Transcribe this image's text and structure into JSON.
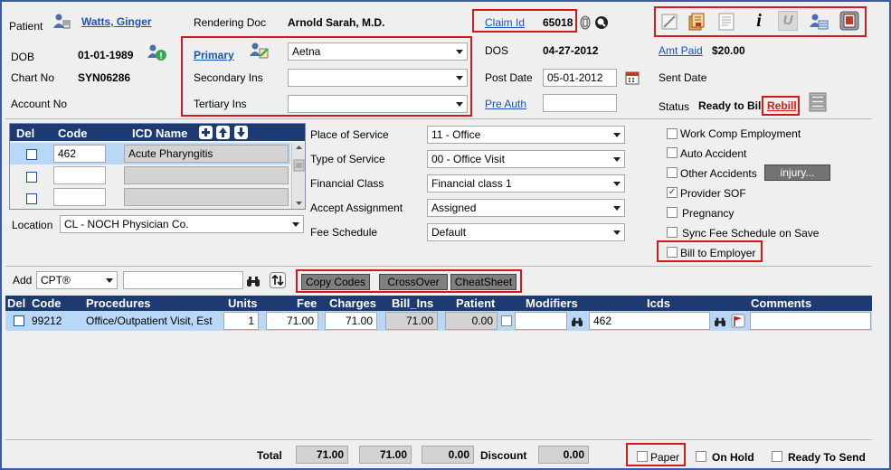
{
  "header": {
    "patient_label": "Patient",
    "patient_name": "Watts, Ginger",
    "rendering_doc_label": "Rendering Doc",
    "rendering_doc_value": "Arnold Sarah, M.D.",
    "claim_id_label": "Claim Id",
    "claim_id_value": "65018",
    "dob_label": "DOB",
    "dob_value": "01-01-1989",
    "chart_no_label": "Chart No",
    "chart_no_value": "SYN06286",
    "account_no_label": "Account No",
    "primary_label": "Primary",
    "primary_value": "Aetna",
    "secondary_label": "Secondary Ins",
    "secondary_value": "",
    "tertiary_label": "Tertiary Ins",
    "tertiary_value": "",
    "dos_label": "DOS",
    "dos_value": "04-27-2012",
    "post_date_label": "Post Date",
    "post_date_value": "05-01-2012",
    "pre_auth_label": "Pre Auth",
    "pre_auth_value": "",
    "amt_paid_label": "Amt Paid",
    "amt_paid_value": "$20.00",
    "sent_date_label": "Sent Date",
    "status_label": "Status",
    "status_value": "Ready to Bill",
    "rebill_label": "Rebill"
  },
  "toolbar": {
    "icons": [
      "edit-icon",
      "documents-icon",
      "notes-icon",
      "info-icon",
      "undo-icon",
      "user-card-icon",
      "print-icon"
    ],
    "info_glyph": "i",
    "undo_glyph": "U"
  },
  "icd": {
    "col_del": "Del",
    "col_code": "Code",
    "col_name": "ICD Name",
    "rows": [
      {
        "code": "462",
        "name": "Acute Pharyngitis"
      },
      {
        "code": "",
        "name": ""
      },
      {
        "code": "",
        "name": ""
      }
    ],
    "location_label": "Location",
    "location_value": "CL - NOCH Physician Co."
  },
  "service": {
    "place_label": "Place of Service",
    "place_value": "11 - Office",
    "type_label": "Type of Service",
    "type_value": "00 - Office Visit",
    "financial_label": "Financial Class",
    "financial_value": "Financial class 1",
    "accept_label": "Accept Assignment",
    "accept_value": "Assigned",
    "fee_label": "Fee Schedule",
    "fee_value": "Default"
  },
  "options": {
    "work_comp": "Work Comp Employment",
    "auto_accident": "Auto Accident",
    "other_accidents": "Other Accidents",
    "injury_button": "injury...",
    "provider_sof": "Provider SOF",
    "pregnancy": "Pregnancy",
    "sync_fee": "Sync Fee Schedule on Save",
    "bill_employer": "Bill to Employer",
    "provider_sof_checked": true
  },
  "add_bar": {
    "add_label": "Add",
    "type_value": "CPT®",
    "search_value": "",
    "copy_codes": "Copy Codes",
    "crossover": "CrossOver",
    "cheatsheet": "CheatSheet"
  },
  "procedures": {
    "headers": [
      "Del",
      "Code",
      "Procedures",
      "Units",
      "Fee",
      "Charges",
      "Bill_Ins",
      "Patient",
      "Modifiers",
      "Icds",
      "Comments"
    ],
    "rows": [
      {
        "code": "99212",
        "procedure": "Office/Outpatient Visit, Est",
        "units": "1",
        "fee": "71.00",
        "charges": "71.00",
        "bill_ins": "71.00",
        "patient": "0.00",
        "modifiers": "",
        "icds": "462",
        "comments": ""
      }
    ]
  },
  "footer": {
    "total_label": "Total",
    "total_charges": "71.00",
    "total_bill_ins": "71.00",
    "total_patient": "0.00",
    "discount_label": "Discount",
    "discount_value": "0.00",
    "paper_label": "Paper",
    "on_hold_label": "On Hold",
    "ready_label": "Ready To Send"
  },
  "colors": {
    "grid_header": "#1d3a73",
    "selected_row": "#b9d7f7",
    "highlight_box": "#d21a1a",
    "link": "#1a54b8"
  }
}
